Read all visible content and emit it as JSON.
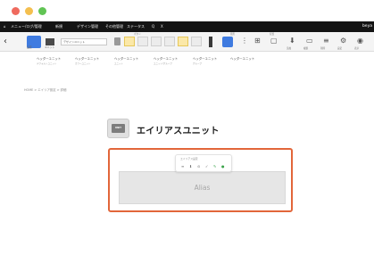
{
  "menubar": {
    "items": [
      "メニュー/ログ/管理",
      "新規",
      "デザイン管理",
      "その他管理",
      "ステータス",
      "Q",
      "X"
    ],
    "brand": "beya"
  },
  "ribbon": {
    "active_tool_label": "",
    "style_select": "デザインユニット",
    "groups": [
      "ボタン",
      "図形",
      "配置"
    ],
    "captions": [
      "設定",
      "ユニット"
    ],
    "right_tools": [
      "追加",
      "複製",
      "削除",
      "設定",
      "表示"
    ]
  },
  "subtabs": [
    {
      "label": "ヘッダーユニット",
      "sub": "デフォルトユニット"
    },
    {
      "label": "ヘッダーユニット",
      "sub": "カラーユニット"
    },
    {
      "label": "ヘッダーユニット",
      "sub": "ユニット"
    },
    {
      "label": "ヘッダーユニット",
      "sub": "ユニット/グループ"
    },
    {
      "label": "ヘッダーユニット",
      "sub": "グループ"
    },
    {
      "label": "ヘッダーユニット",
      "sub": ""
    }
  ],
  "breadcrumb": "HOME > エイリア設定 > 詳細",
  "unit": {
    "icon_text": "UNIT",
    "title": "エイリアスユニット"
  },
  "popup": {
    "title": "エイリアス設定",
    "icons": [
      "≡",
      "⬇",
      "⊙",
      "✓",
      "✎",
      "●"
    ]
  },
  "alias": {
    "label": "Alias"
  },
  "colors": {
    "highlight": "#e2663a",
    "accent": "#3f7be0"
  }
}
